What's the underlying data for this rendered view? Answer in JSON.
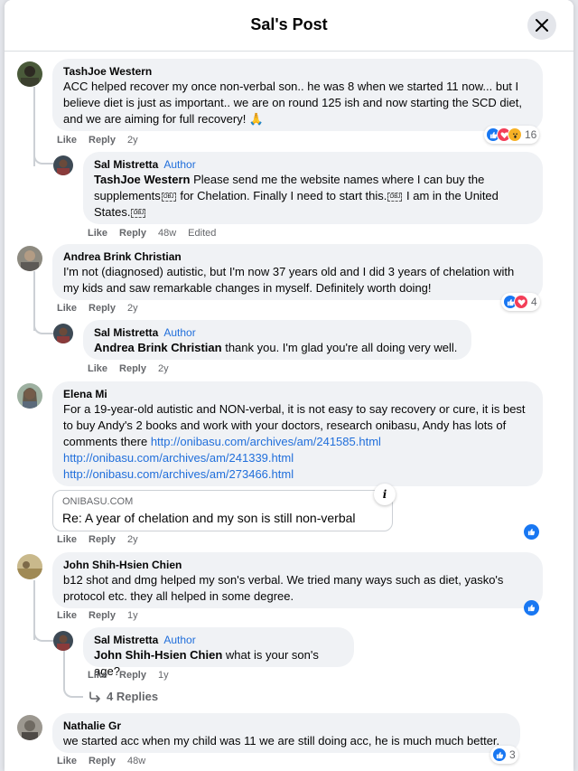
{
  "header": {
    "title": "Sal's Post",
    "close_icon": "close-icon"
  },
  "comments": [
    {
      "name": "TashJoe Western",
      "text": "ACC helped recover my once non-verbal son.. he was 8 when we started 11 now... but I believe diet is just as important.. we are on round 125 ish and now starting the SCD diet, and we are aiming for full recovery! 🙏",
      "like": "Like",
      "reply": "Reply",
      "time": "2y",
      "reaction_count": "16"
    },
    {
      "name": "Sal Mistretta",
      "author": "Author",
      "mention": "TashJoe Western",
      "text_a": " Please send me the website names where I can buy the supplements",
      "text_b": " for Chelation. Finally I need to start this.",
      "text_c": " I am in the United States.",
      "like": "Like",
      "reply": "Reply",
      "time": "48w",
      "edited": "Edited"
    },
    {
      "name": "Andrea Brink Christian",
      "text": "I'm not (diagnosed) autistic, but I'm now 37 years old and I did 3 years of chelation with my kids and saw remarkable changes in myself. Definitely worth doing!",
      "like": "Like",
      "reply": "Reply",
      "time": "2y",
      "reaction_count": "4"
    },
    {
      "name": "Sal Mistretta",
      "author": "Author",
      "mention": "Andrea Brink Christian",
      "text": " thank you. I'm glad you're all doing very well.",
      "like": "Like",
      "reply": "Reply",
      "time": "2y"
    },
    {
      "name": "Elena Mi",
      "text": "For a 19-year-old autistic and NON-verbal, it is not easy to say recovery or cure, it is best to buy Andy's 2 books and work with your doctors, research onibasu, Andy has lots of comments there ",
      "link1": "http://onibasu.com/archives/am/241585.html",
      "link2": "http://onibasu.com/archives/am/241339.html",
      "link3": "http://onibasu.com/archives/am/273466.html",
      "preview_domain": "ONIBASU.COM",
      "preview_title": "Re: A year of chelation and my son is still non-verbal",
      "like": "Like",
      "reply": "Reply",
      "time": "2y"
    },
    {
      "name": "John Shih-Hsien Chien",
      "text": "b12 shot and dmg helped my son's verbal. We tried many ways such as diet, yasko's protocol etc. they all helped in some degree.",
      "like": "Like",
      "reply": "Reply",
      "time": "1y"
    },
    {
      "name": "Sal Mistretta",
      "author": "Author",
      "mention": "John Shih-Hsien Chien",
      "text": " what is your son's age?",
      "like": "Like",
      "reply": "Reply",
      "time": "1y",
      "replies_label": "4 Replies"
    },
    {
      "name": "Nathalie Gr",
      "text": "we started acc when my child was 11 we are still doing acc, he is much much better.",
      "like": "Like",
      "reply": "Reply",
      "time": "48w",
      "reaction_count": "3"
    }
  ],
  "colors": {
    "link": "#216fdb",
    "like": "#1877f2",
    "love": "#f33e58",
    "wow": "#f7b125",
    "bubble": "#f0f2f5"
  }
}
